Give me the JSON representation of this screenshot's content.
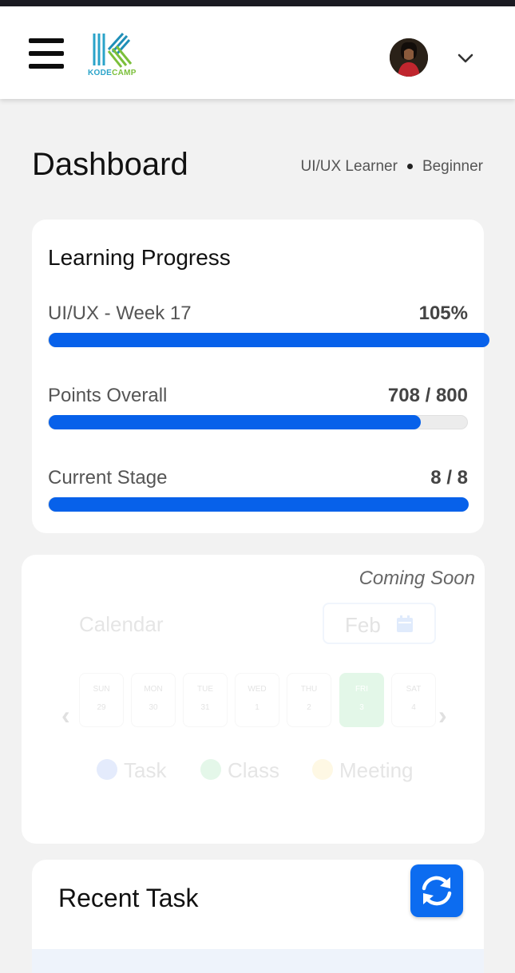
{
  "header": {
    "logo_text_a": "KODE",
    "logo_text_b": "CAMP"
  },
  "page": {
    "title": "Dashboard",
    "role": "UI/UX Learner",
    "level": "Beginner"
  },
  "progress": {
    "title": "Learning Progress",
    "rows": [
      {
        "label": "UI/UX - Week 17",
        "value": "105%",
        "fraction": 1.05
      },
      {
        "label": "Points Overall",
        "value": "708 / 800",
        "fraction": 0.885
      },
      {
        "label": "Current Stage",
        "value": "8 / 8",
        "fraction": 1.0
      }
    ],
    "bar_color": "#0761ea"
  },
  "calendar": {
    "badge": "Coming Soon",
    "title": "Calendar",
    "month": "Feb",
    "days": [
      {
        "name": "SUN",
        "date": "29"
      },
      {
        "name": "MON",
        "date": "30"
      },
      {
        "name": "TUE",
        "date": "31"
      },
      {
        "name": "WED",
        "date": "1"
      },
      {
        "name": "THU",
        "date": "2"
      },
      {
        "name": "FRI",
        "date": "3"
      },
      {
        "name": "SAT",
        "date": "4"
      }
    ],
    "legend": [
      {
        "label": "Task",
        "color": "#3a6fe8"
      },
      {
        "label": "Class",
        "color": "#39c463"
      },
      {
        "label": "Meeting",
        "color": "#f2cc3c"
      }
    ]
  },
  "recent": {
    "title": "Recent Task"
  }
}
